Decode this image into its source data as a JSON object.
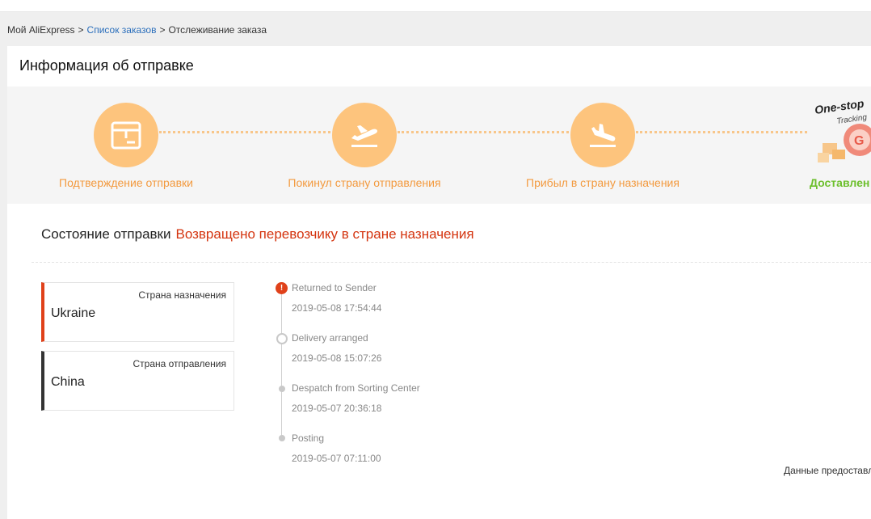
{
  "breadcrumb": {
    "home": "Мой AliExpress",
    "orders": "Список заказов",
    "current": "Отслеживание заказа",
    "separator": ">"
  },
  "section_title": "Информация об отправке",
  "steps": [
    {
      "label": "Подтверждение отправки",
      "icon": "package-icon"
    },
    {
      "label": "Покинул страну отправления",
      "icon": "plane-takeoff-icon"
    },
    {
      "label": "Прибыл в страну назначения",
      "icon": "plane-landing-icon"
    },
    {
      "label": "Доставлен",
      "icon": "one-stop-tracking-icon"
    }
  ],
  "onestop": {
    "title": "One-stop",
    "subtitle": "Tracking"
  },
  "status": {
    "label": "Состояние отправки",
    "value": "Возвращено перевозчику в стране назначения"
  },
  "countries": {
    "destination": {
      "label": "Страна назначения",
      "name": "Ukraine"
    },
    "origin": {
      "label": "Страна отправления",
      "name": "China"
    }
  },
  "events": [
    {
      "desc": "Returned to Sender",
      "time": "2019-05-08 17:54:44"
    },
    {
      "desc": "Delivery arranged",
      "time": "2019-05-08 15:07:26"
    },
    {
      "desc": "Despatch from Sorting Center",
      "time": "2019-05-07 20:36:18"
    },
    {
      "desc": "Posting",
      "time": "2019-05-07 07:11:00"
    }
  ],
  "provided_by": "Данные предоставл",
  "colors": {
    "accent": "#fdc47d",
    "label": "#f39a3f",
    "done": "#6cbf2c",
    "status": "#d4340f",
    "link": "#2a6ebb"
  }
}
